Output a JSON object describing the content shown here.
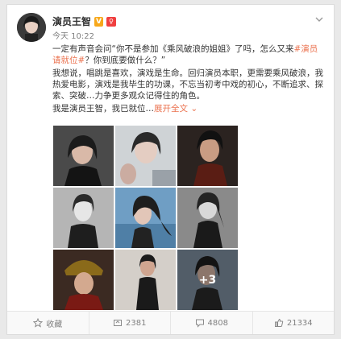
{
  "post": {
    "author": "演员王智",
    "vip_badge": "V",
    "level_badge": "♀",
    "time": "今天 10:22",
    "paragraphs": {
      "p1_before": "一定有声音会问“你不是参加《乘风破浪的姐姐》了吗，怎么又来",
      "p1_tag": "#演员请就位#",
      "p1_after": "？你到底要做什么？”",
      "p2": "我想说，唱跳是喜欢，演戏是生命。回归演员本职，更需要乘风破浪，我热爱电影，演戏是我毕生的功课，不忘当初考中戏的初心，不断追求、探索、突破…力争更多观众记得住的角色。",
      "p3_before": "我是演员王智，我已就位…",
      "p3_link": "展开全文",
      "p3_chevron": "⌄"
    },
    "more_images": "+3",
    "icons": {
      "menu": "chevron-down-icon",
      "favorite": "star-icon",
      "repost": "repost-icon",
      "comment": "comment-icon",
      "like": "thumbs-up-icon"
    }
  },
  "actions": {
    "favorite": "收藏",
    "repost": "2381",
    "comment": "4808",
    "like": "21334"
  },
  "colors": {
    "accent": "#eb7350",
    "text": "#333333",
    "muted": "#808080"
  }
}
